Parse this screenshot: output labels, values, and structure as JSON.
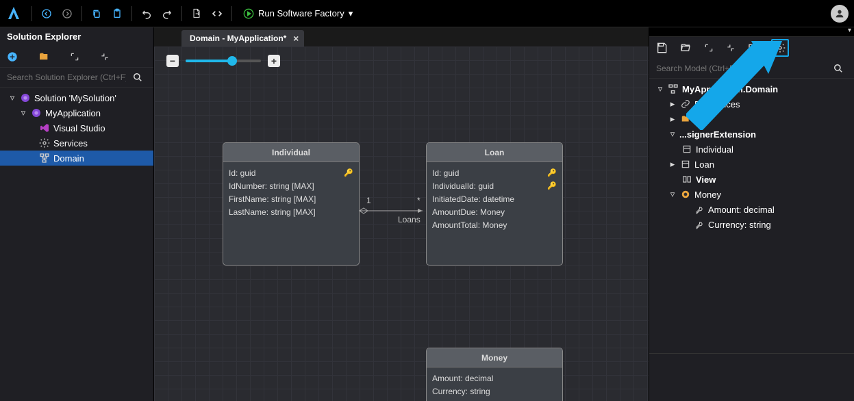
{
  "topbar": {
    "run_label": "Run Software Factory"
  },
  "left": {
    "title": "Solution Explorer",
    "search_placeholder": "Search Solution Explorer (Ctrl+F)",
    "tree": {
      "solution": "Solution 'MySolution'",
      "app": "MyApplication",
      "vs": "Visual Studio",
      "services": "Services",
      "domain": "Domain"
    }
  },
  "tab": {
    "label": "Domain - MyApplication*"
  },
  "entities": {
    "individual": {
      "title": "Individual",
      "rows": [
        "Id: guid",
        "IdNumber: string [MAX]",
        "FirstName: string [MAX]",
        "LastName: string [MAX]"
      ]
    },
    "loan": {
      "title": "Loan",
      "rows": [
        "Id: guid",
        "IndividualId: guid",
        "InitiatedDate: datetime",
        "AmountDue: Money",
        "AmountTotal: Money"
      ]
    },
    "money": {
      "title": "Money",
      "rows": [
        "Amount: decimal",
        "Currency: string"
      ]
    }
  },
  "relation": {
    "from": "1",
    "to": "*",
    "label": "Loans"
  },
  "right": {
    "search_placeholder": "Search Model (Ctrl+F)",
    "tree": {
      "root": "MyApplication.Domain",
      "refs": "References",
      "b": "B...",
      "ext": "...signerExtension",
      "individual": "Individual",
      "loan": "Loan",
      "view": "View",
      "money": "Money",
      "amount": "Amount: decimal",
      "currency": "Currency: string"
    }
  }
}
